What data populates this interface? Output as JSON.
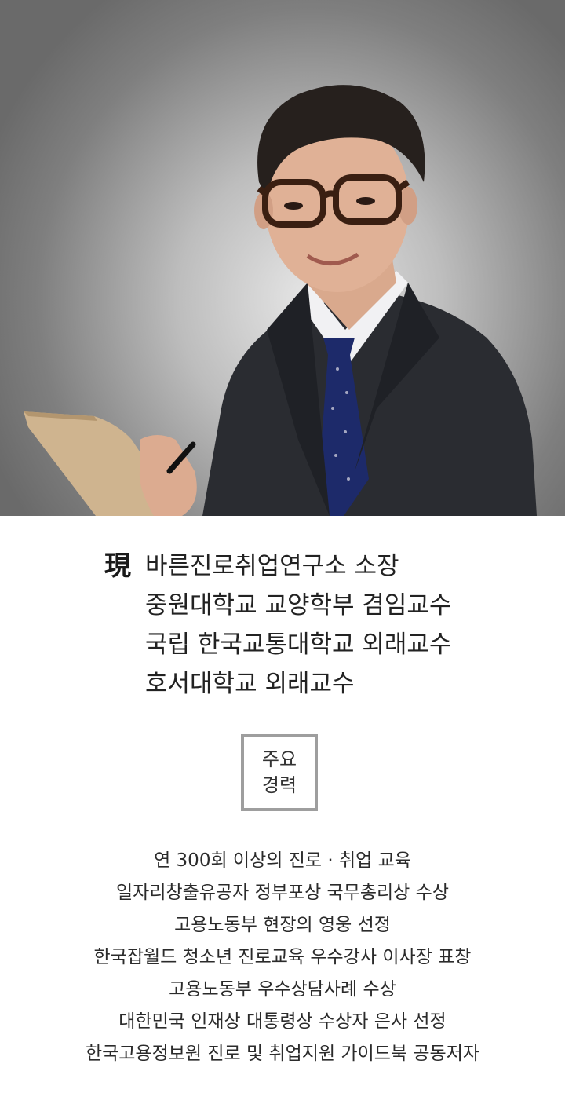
{
  "profile": {
    "photo_alt": "portrait",
    "current_prefix": "現",
    "positions": [
      "바른진로취업연구소 소장",
      "중원대학교 교양학부 겸임교수",
      "국립 한국교통대학교 외래교수",
      "호서대학교 외래교수"
    ]
  },
  "career_box": {
    "line1": "주요",
    "line2": "경력"
  },
  "career_items": [
    "연 300회 이상의 진로 · 취업 교육",
    "일자리창출유공자 정부포상 국무총리상 수상",
    "고용노동부 현장의 영웅 선정",
    "한국잡월드 청소년 진로교육 우수강사 이사장 표창",
    "고용노동부 우수상담사례 수상",
    "대한민국 인재상 대통령상 수상자 은사 선정",
    "한국고용정보원 진로 및 취업지원 가이드북 공동저자"
  ]
}
